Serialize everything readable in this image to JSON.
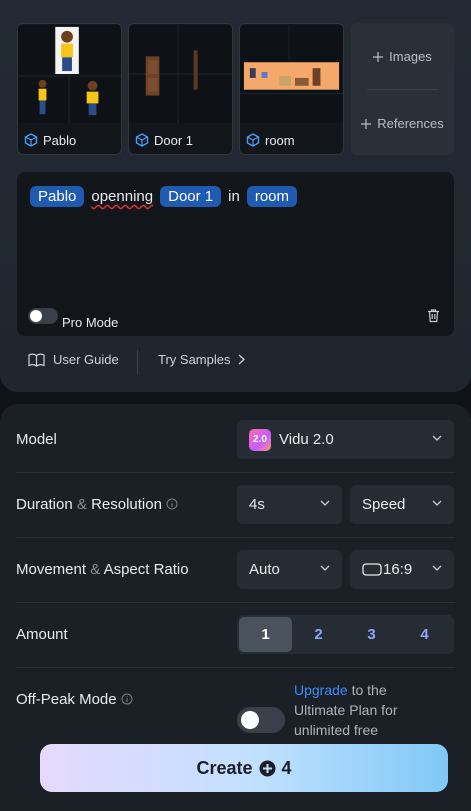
{
  "references": [
    {
      "label": "Pablo",
      "icon": "cube-icon"
    },
    {
      "label": "Door 1",
      "icon": "cube-icon"
    },
    {
      "label": "room",
      "icon": "cube-icon"
    }
  ],
  "add_buttons": {
    "images": "Images",
    "references": "References"
  },
  "prompt": {
    "chip1": "Pablo",
    "word1": "openning",
    "chip2": "Door 1",
    "word2": "in",
    "chip3": "room"
  },
  "pro_mode": {
    "label": "Pro Mode",
    "enabled": false
  },
  "links": {
    "user_guide": "User Guide",
    "try_samples": "Try Samples"
  },
  "settings": {
    "model_label": "Model",
    "model_value": "Vidu 2.0",
    "model_badge": "2.0",
    "duration_label_a": "Duration",
    "duration_label_amp": "&",
    "duration_label_b": "Resolution",
    "duration_value": "4s",
    "resolution_value": "Speed",
    "movement_label_a": "Movement",
    "movement_label_amp": "&",
    "movement_label_b": "Aspect Ratio",
    "movement_value": "Auto",
    "aspect_value": "16:9",
    "amount_label": "Amount",
    "amount_options": [
      "1",
      "2",
      "3",
      "4"
    ],
    "amount_selected": "1",
    "offpeak_label": "Off-Peak Mode",
    "offpeak_enabled": false,
    "offpeak_link": "Upgrade",
    "offpeak_text": " to the Ultimate Plan for unlimited free"
  },
  "create": {
    "label": "Create",
    "cost": "4"
  },
  "colors": {
    "accent_chip": "#1f5bb0",
    "link": "#3d8cff",
    "amount_text": "#8fa6ff"
  }
}
